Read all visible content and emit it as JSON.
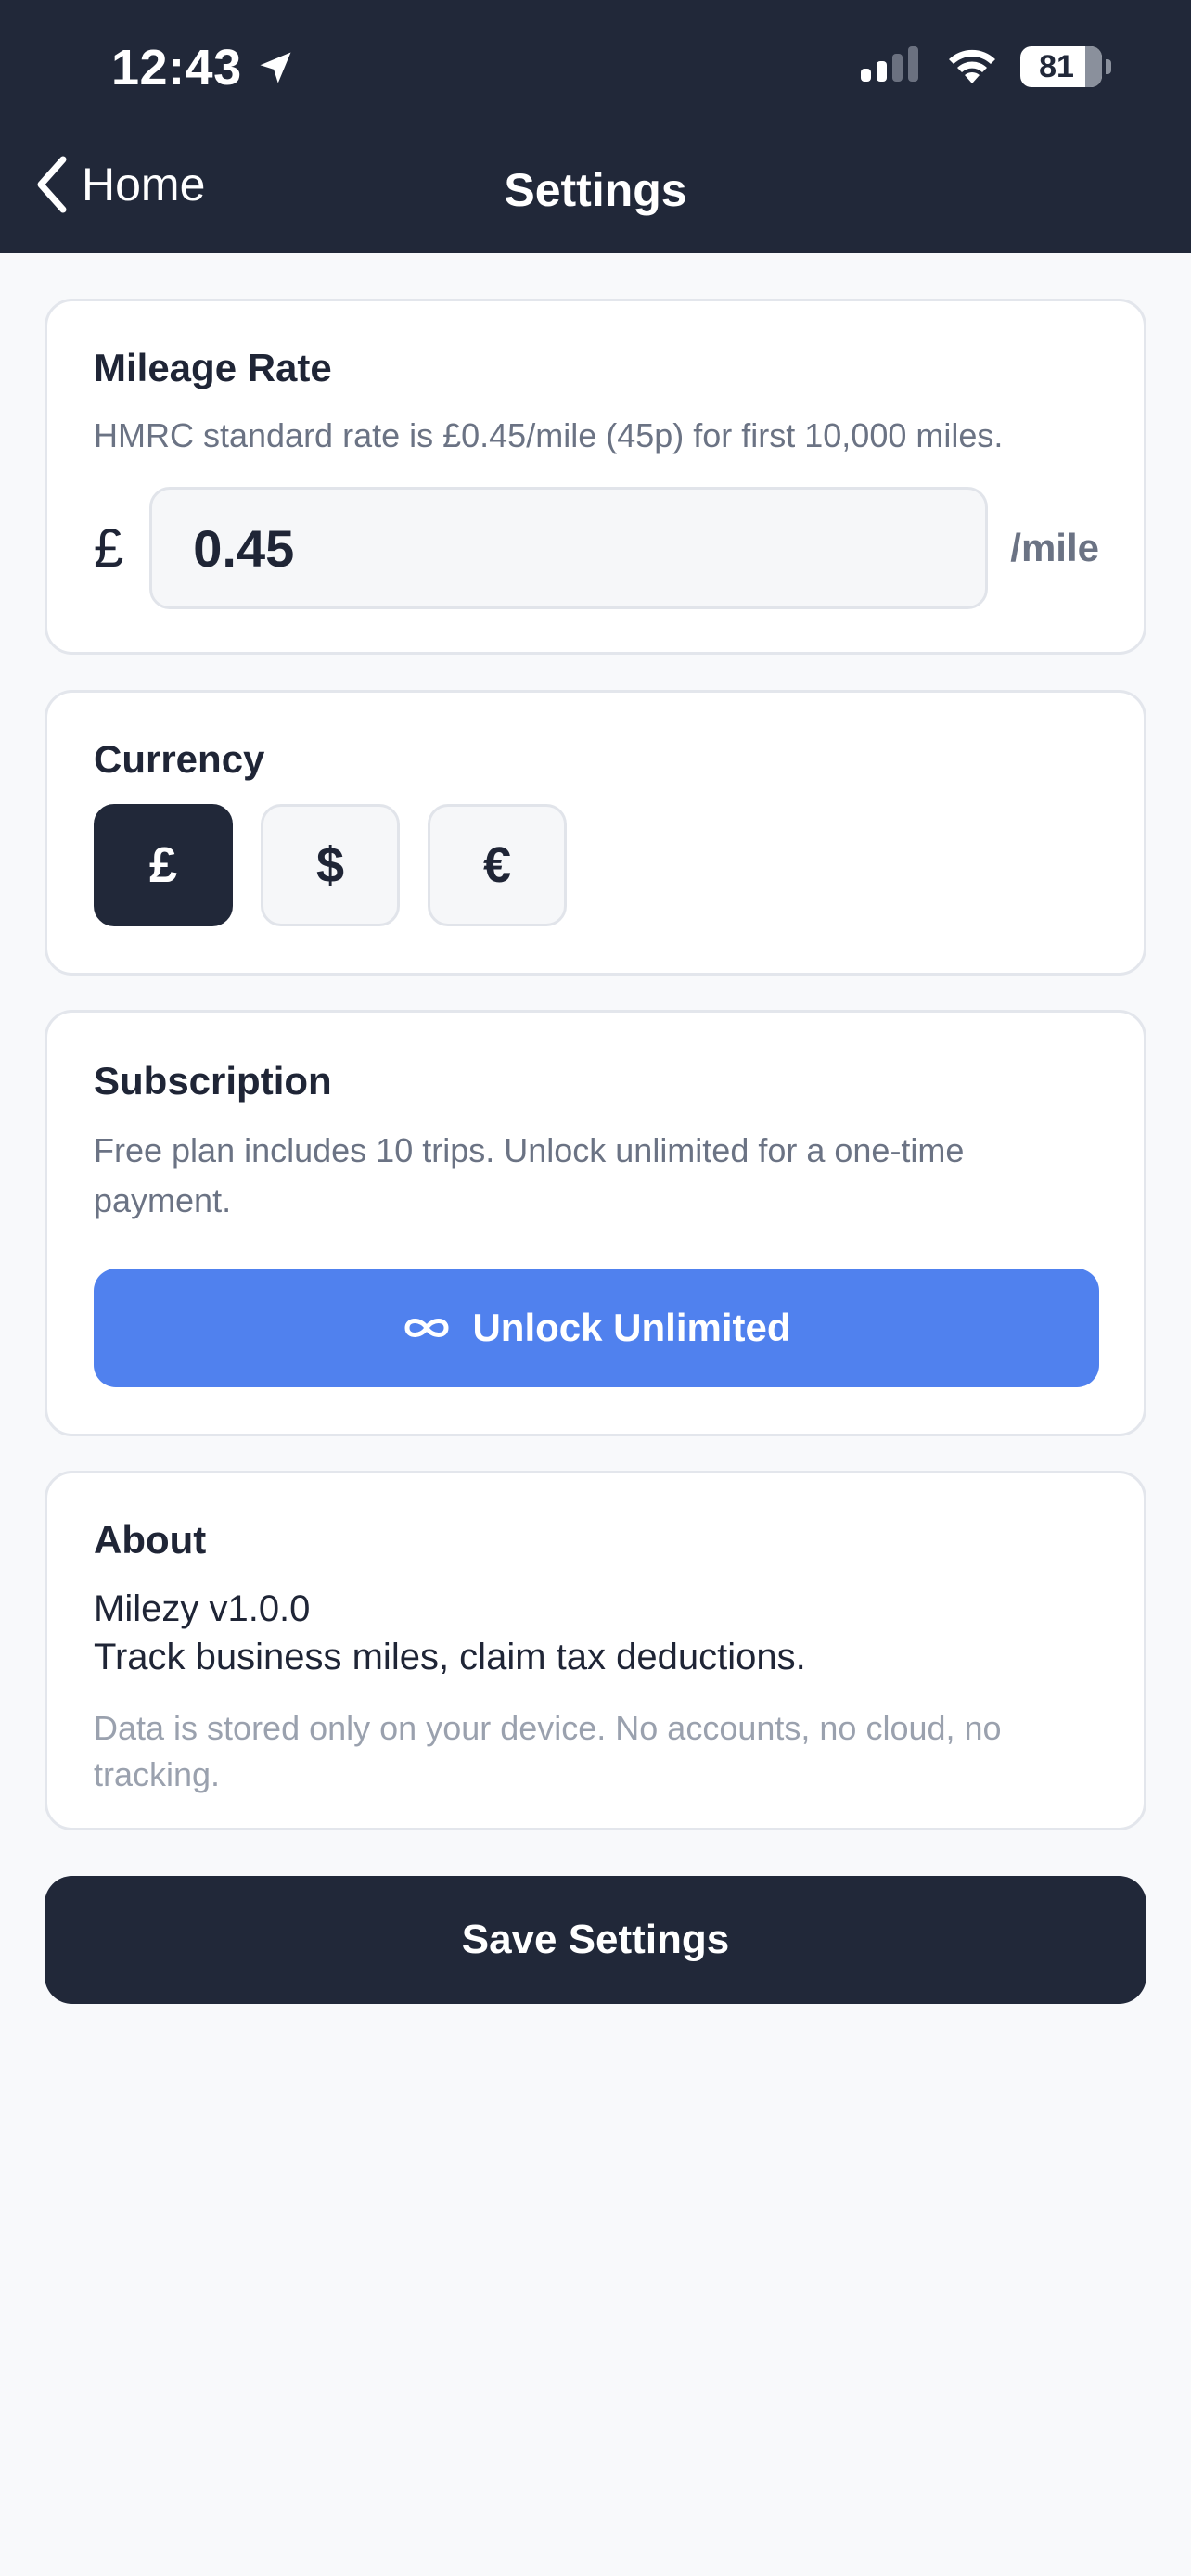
{
  "status_bar": {
    "time": "12:43",
    "battery": "81"
  },
  "nav": {
    "back_label": "Home",
    "title": "Settings"
  },
  "mileage": {
    "title": "Mileage Rate",
    "helper": "HMRC standard rate is £0.45/mile (45p) for first 10,000 miles.",
    "symbol": "£",
    "value": "0.45",
    "unit": "/mile"
  },
  "currency": {
    "title": "Currency",
    "options": [
      "£",
      "$",
      "€"
    ],
    "selected": "£"
  },
  "subscription": {
    "title": "Subscription",
    "helper": "Free plan includes 10 trips. Unlock unlimited for a one-time payment.",
    "button_label": "Unlock Unlimited"
  },
  "about": {
    "title": "About",
    "version": "Milezy v1.0.0",
    "tagline": "Track business miles, claim tax deductions.",
    "note": "Data is stored only on your device. No accounts, no cloud, no tracking."
  },
  "save_label": "Save Settings",
  "colors": {
    "header_bg": "#212839",
    "accent_blue": "#5081ee",
    "page_bg": "#f8f9fb"
  }
}
